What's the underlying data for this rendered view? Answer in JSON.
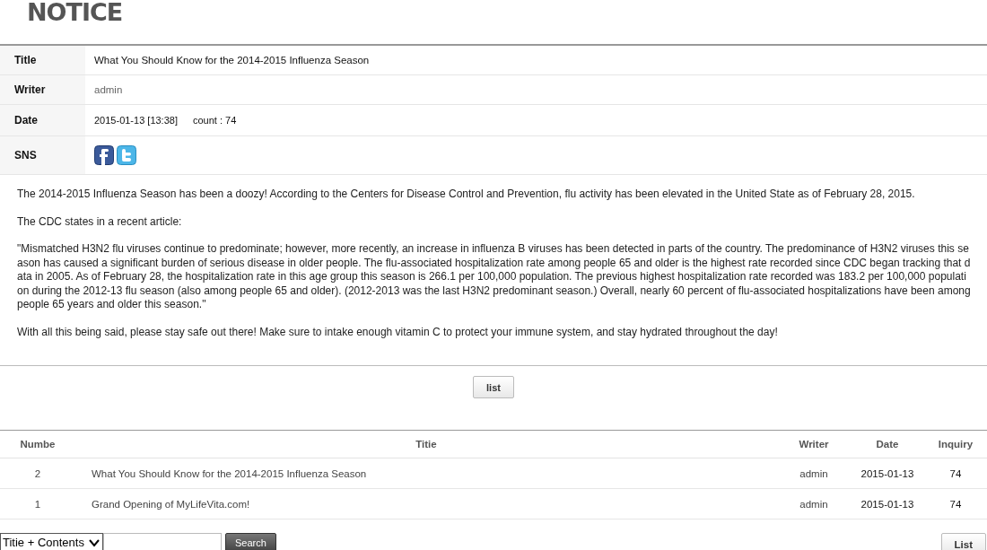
{
  "heading": "NOTICE",
  "details": [
    {
      "kind": "text",
      "label": "Title",
      "value": "What You Should Know for the 2014-2015 Influenza Season"
    },
    {
      "kind": "muted",
      "label": "Writer",
      "value": "admin"
    },
    {
      "kind": "date",
      "label": "Date",
      "value": "2015-01-13 [13:38]",
      "count": "count : 74"
    },
    {
      "kind": "sns",
      "label": "SNS"
    }
  ],
  "body": [
    "The 2014-2015 Influenza Season has been a doozy! According to the Centers for Disease Control and Prevention, flu activity has been elevated in the United State as of February 28, 2015.",
    "The CDC states in a recent article:",
    "\"Mismatched H3N2 flu viruses continue to predominate; however, more recently, an increase in influenza B viruses has been detected in parts of the country. The predominance of H3N2 viruses this season has caused a significant burden of serious disease in older people. The flu-associated hospitalization rate among people 65 and older is the highest rate recorded since CDC began tracking that data in 2005. As of February 28, the hospitalization rate in this age group this season is 266.1 per 100,000 population. The previous highest hospitalization rate recorded was 183.2 per 100,000 population during the 2012-13 flu season (also among people 65 and older). (2012-2013 was the last H3N2 predominant season.) Overall, nearly 60 percent of flu-associated hospitalizations have been among people 65 years and older this season.\"",
    "With all this being said, please stay safe out there! Make sure to intake enough vitamin C to protect your immune system, and stay hydrated throughout the day!"
  ],
  "list_button": "list",
  "table": {
    "columns": [
      "Numbe",
      "Titie",
      "Writer",
      "Date",
      "Inquiry"
    ],
    "rows": [
      {
        "number": "2",
        "title": "What You Should Know for the 2014-2015 Influenza Season",
        "writer": "admin",
        "date": "2015-01-13",
        "inquiry": "74"
      },
      {
        "number": "1",
        "title": "Grand Opening of MyLifeVita.com!",
        "writer": "admin",
        "date": "2015-01-13",
        "inquiry": "74"
      }
    ]
  },
  "search": {
    "scope": "Titie + Contents",
    "button": "Search"
  },
  "bottom_button": "List"
}
